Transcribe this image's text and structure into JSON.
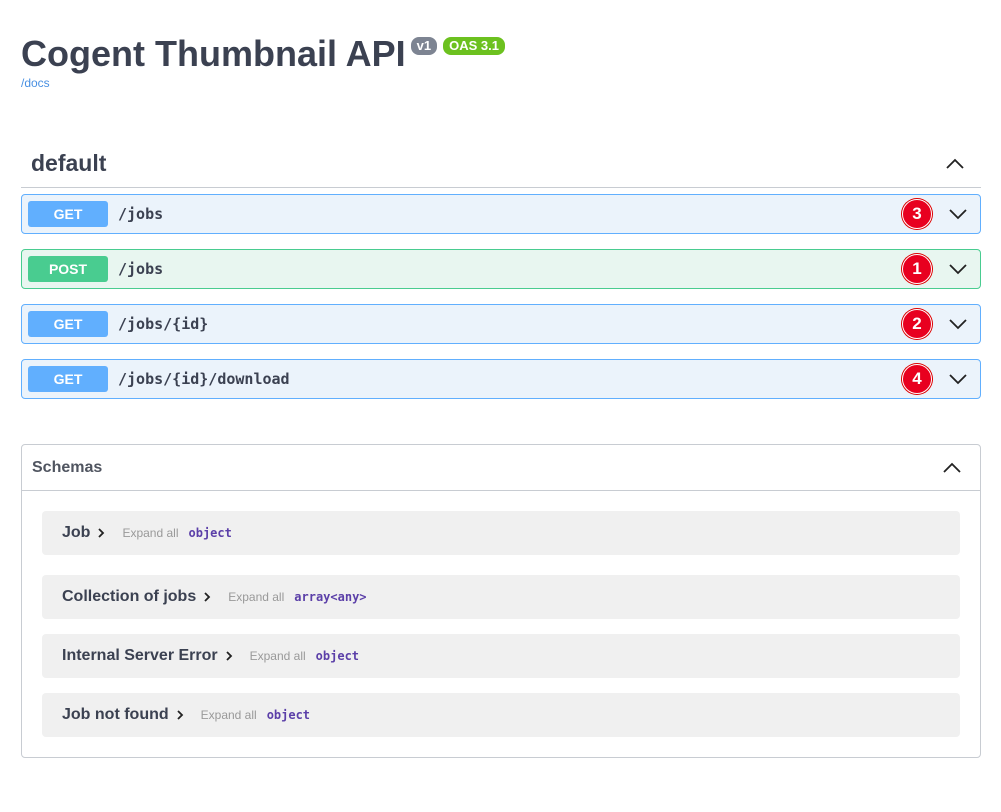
{
  "info": {
    "title": "Cogent Thumbnail API",
    "version": "v1",
    "oas": "OAS 3.1",
    "docs_link": "/docs"
  },
  "tag": {
    "name": "default"
  },
  "operations": [
    {
      "method": "GET",
      "path": "/jobs",
      "number": "3"
    },
    {
      "method": "POST",
      "path": "/jobs",
      "number": "1"
    },
    {
      "method": "GET",
      "path": "/jobs/{id}",
      "number": "2"
    },
    {
      "method": "GET",
      "path": "/jobs/{id}/download",
      "number": "4"
    }
  ],
  "schemas": {
    "title": "Schemas",
    "expand_label": "Expand all",
    "models": [
      {
        "name": "Job",
        "type": "object"
      },
      {
        "name": "Collection of jobs",
        "type": "array<any>"
      },
      {
        "name": "Internal Server Error",
        "type": "object"
      },
      {
        "name": "Job not found",
        "type": "object"
      }
    ]
  },
  "colors": {
    "get": "#61affe",
    "post": "#49cc90",
    "badge": "#e8001f"
  }
}
